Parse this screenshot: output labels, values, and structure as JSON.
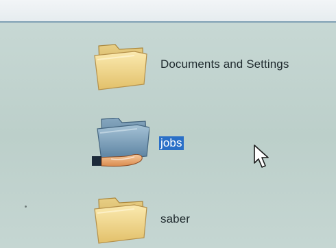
{
  "folders": [
    {
      "name": "Documents and Settings",
      "icon": "folder-icon",
      "selected": false,
      "shared": false
    },
    {
      "name": "jobs",
      "icon": "shared-folder-icon",
      "selected": true,
      "shared": true
    },
    {
      "name": "saber",
      "icon": "folder-icon",
      "selected": false,
      "shared": false
    }
  ],
  "colors": {
    "selection_background": "#2a6fc7",
    "folder_yellow": "#f1d98a",
    "folder_blue": "#6f97b7",
    "background": "#c2d4cf"
  },
  "cursor": {
    "icon": "mouse-pointer-icon"
  }
}
